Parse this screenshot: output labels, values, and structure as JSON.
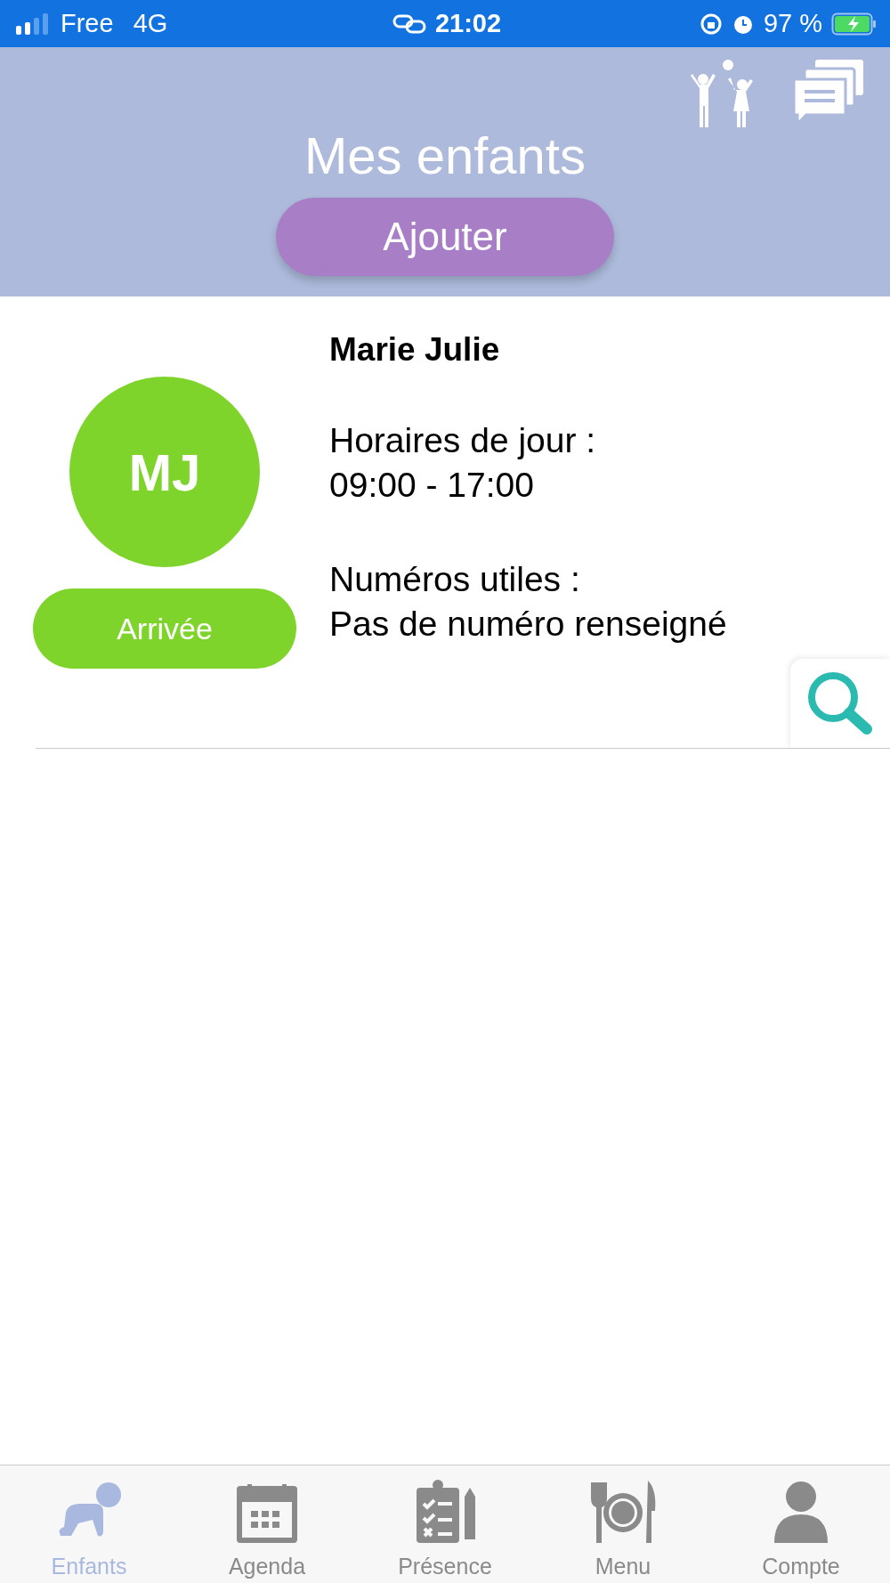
{
  "status_bar": {
    "carrier": "Free",
    "network": "4G",
    "time": "21:02",
    "battery": "97 %"
  },
  "header": {
    "title": "Mes enfants",
    "add_button": "Ajouter"
  },
  "children": [
    {
      "initials": "MJ",
      "name": "Marie Julie",
      "schedule_label": "Horaires de jour :",
      "schedule": "09:00 - 17:00",
      "phones_label": "Numéros utiles :",
      "phones": "Pas de numéro renseigné",
      "arrival_button": "Arrivée"
    }
  ],
  "tabs": [
    {
      "label": "Enfants",
      "selected": true,
      "kind": "baby"
    },
    {
      "label": "Agenda",
      "selected": false,
      "kind": "calendar"
    },
    {
      "label": "Présence",
      "selected": false,
      "kind": "clipboard"
    },
    {
      "label": "Menu",
      "selected": false,
      "kind": "dinner"
    },
    {
      "label": "Compte",
      "selected": false,
      "kind": "person"
    }
  ]
}
